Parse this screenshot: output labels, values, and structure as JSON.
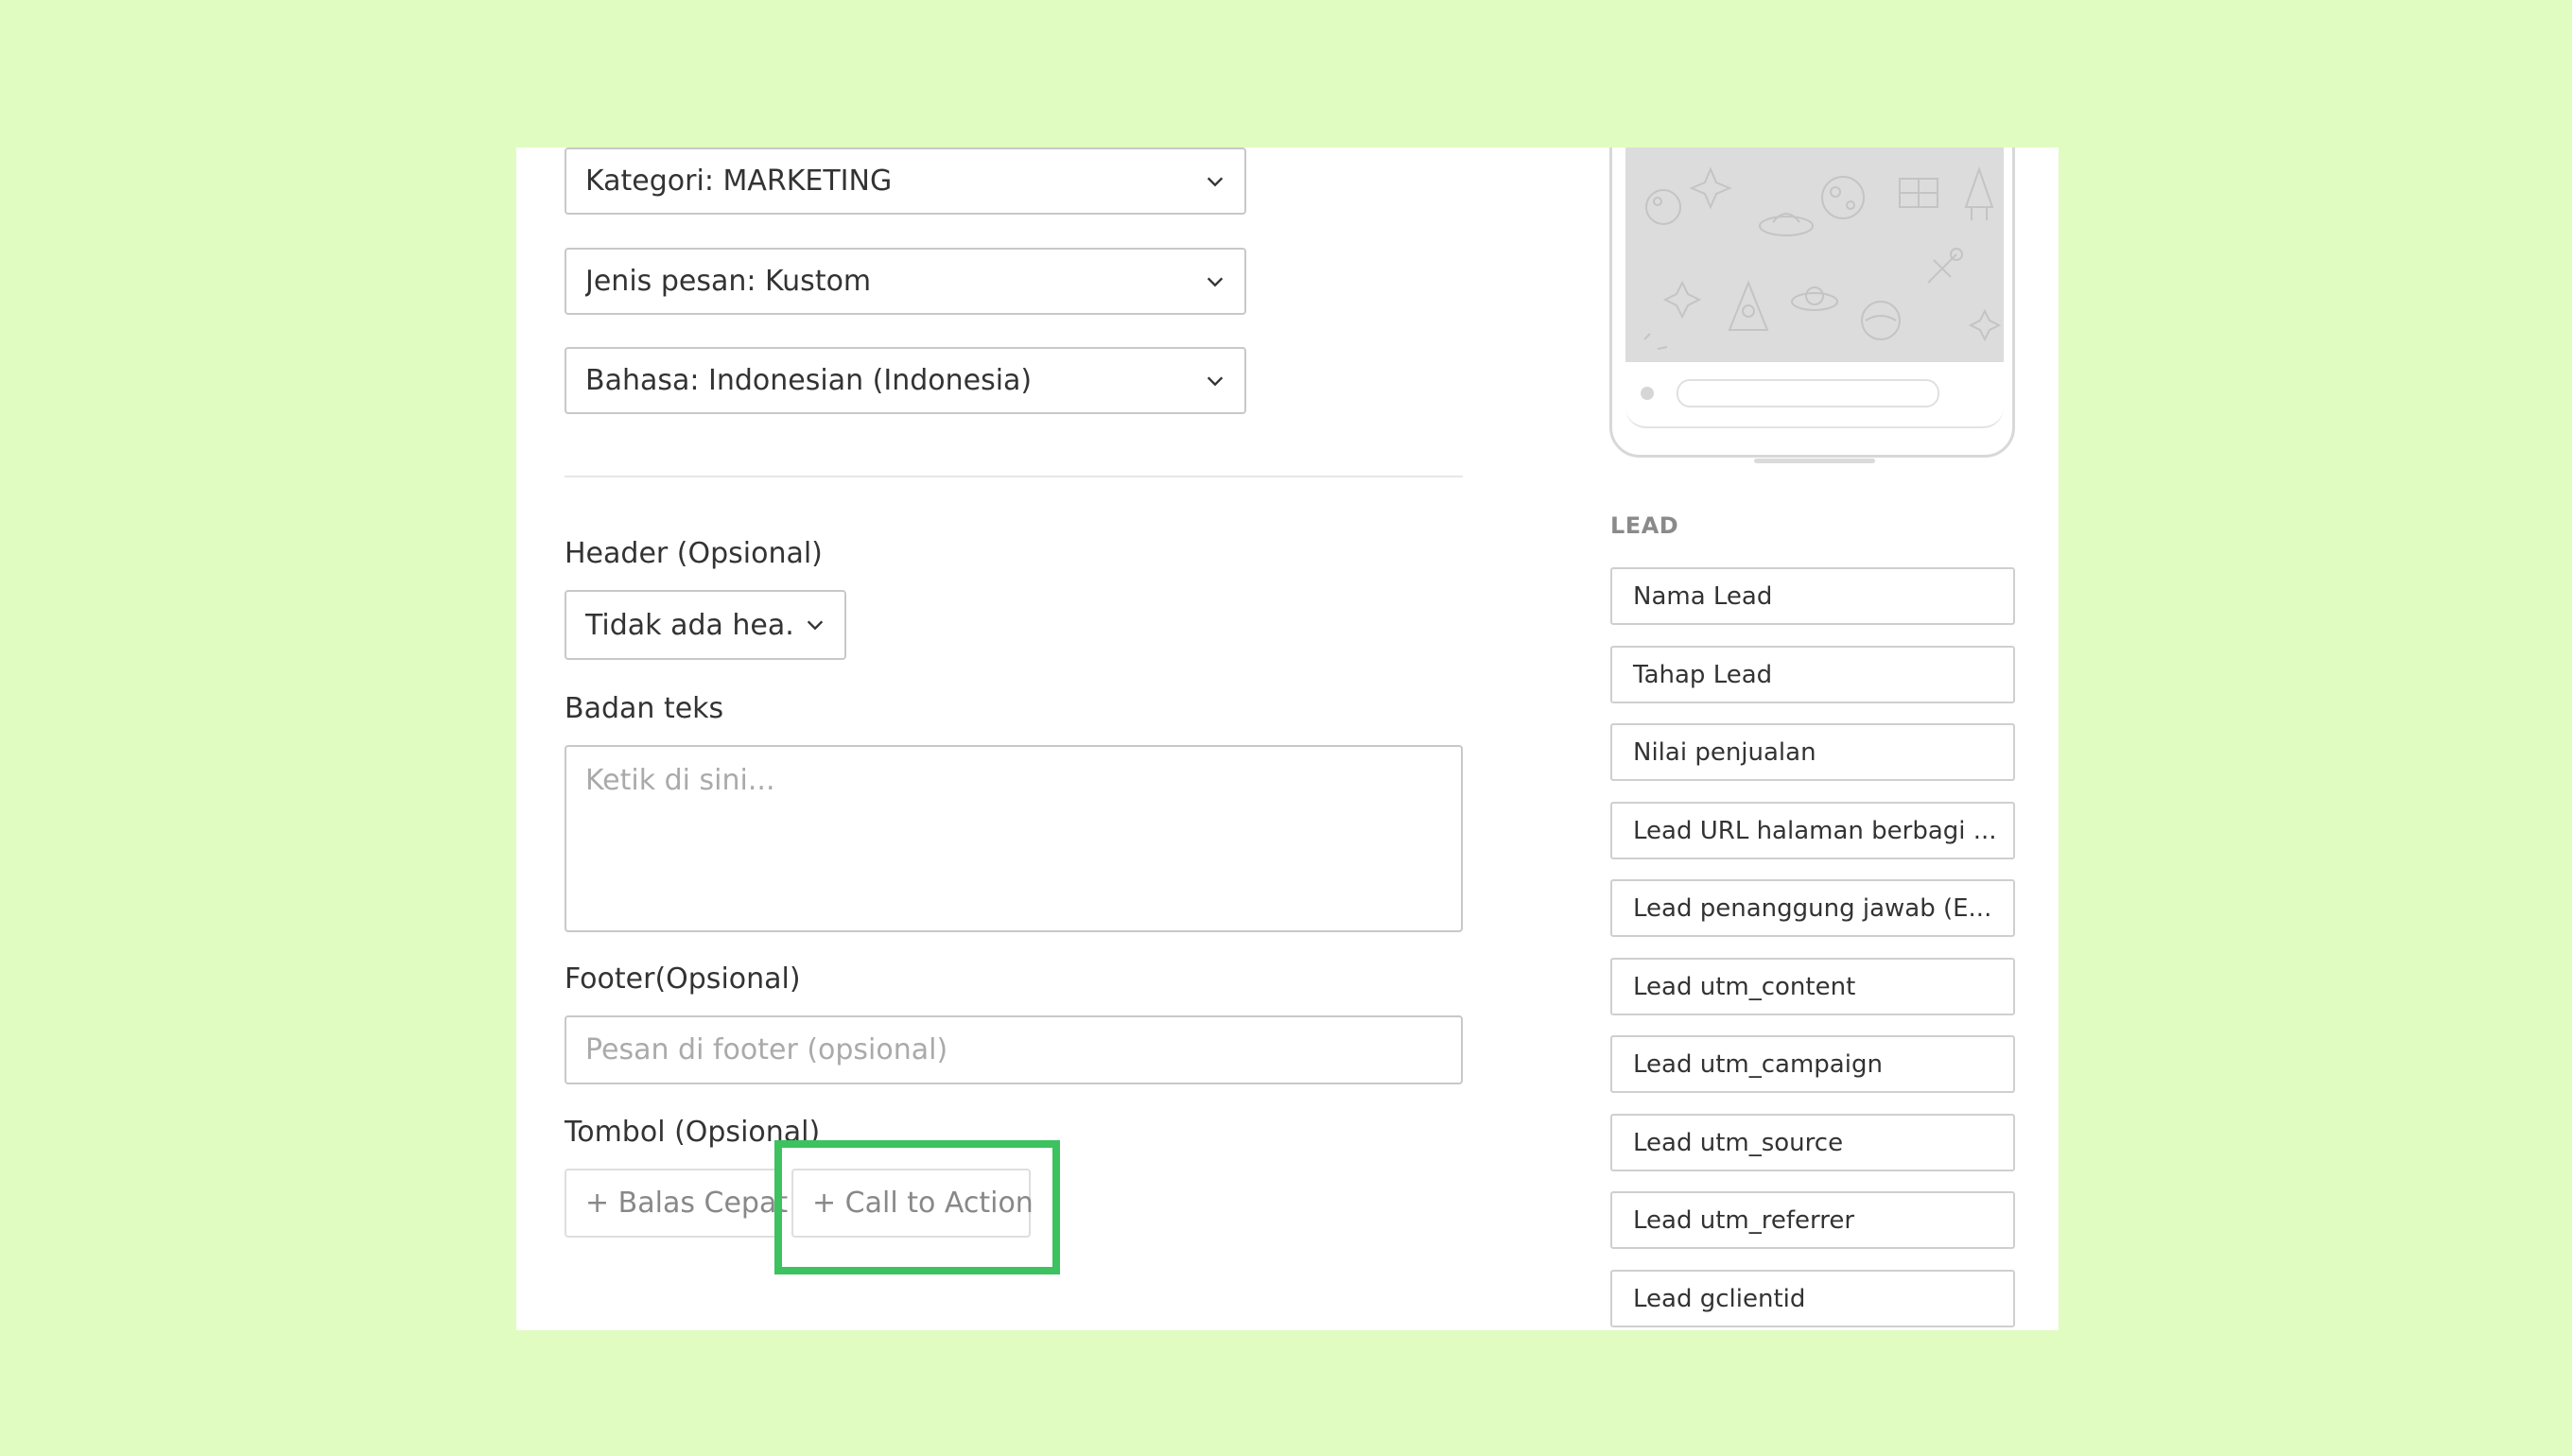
{
  "form": {
    "category_select": "Kategori: MARKETING",
    "message_type_select": "Jenis pesan: Kustom",
    "language_select": "Bahasa: Indonesian (Indonesia)",
    "header_label": "Header (Opsional)",
    "header_select": "Tidak ada hea...",
    "body_label": "Badan teks",
    "body_placeholder": "Ketik di sini...",
    "footer_label": "Footer(Opsional)",
    "footer_placeholder": "Pesan di footer (opsional)",
    "buttons_label": "Tombol (Opsional)",
    "quick_reply_button": "+ Balas Cepat",
    "call_to_action_button": "+ Call to Action"
  },
  "sidebar": {
    "section_title": "LEAD",
    "items": [
      "Nama Lead",
      "Tahap Lead",
      "Nilai penjualan",
      "Lead URL halaman berbagi ...",
      "Lead penanggung jawab (E...",
      "Lead utm_content",
      "Lead utm_campaign",
      "Lead utm_source",
      "Lead utm_referrer",
      "Lead gclientid"
    ]
  },
  "colors": {
    "background": "#e0fcc0",
    "highlight": "#3cc25e"
  }
}
